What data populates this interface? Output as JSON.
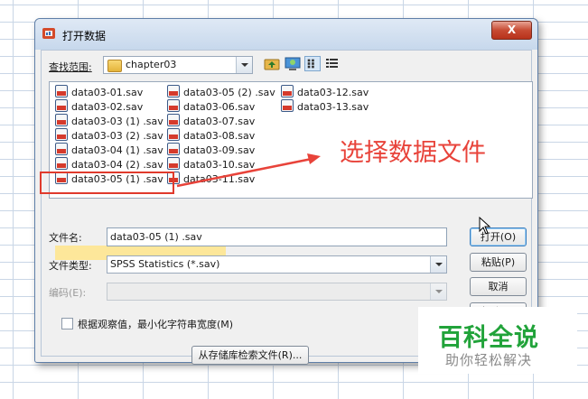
{
  "window": {
    "title": "打开数据",
    "close_label": "X"
  },
  "lookin": {
    "label": "查找范围:",
    "value": "chapter03"
  },
  "toolbar_icons": [
    "up-folder-icon",
    "desktop-icon",
    "list-view-icon",
    "details-view-icon"
  ],
  "files": {
    "col1": [
      "data03-01.sav",
      "data03-02.sav",
      "data03-03 (1) .sav",
      "data03-03 (2) .sav",
      "data03-04 (1) .sav",
      "data03-04 (2) .sav",
      "data03-05 (1) .sav"
    ],
    "col2": [
      "data03-05 (2) .sav",
      "data03-06.sav",
      "data03-07.sav",
      "data03-08.sav",
      "data03-09.sav",
      "data03-10.sav",
      "data03-11.sav"
    ],
    "col3": [
      "data03-12.sav",
      "data03-13.sav"
    ],
    "selected": "data03-05 (1) .sav"
  },
  "annotation": "选择数据文件",
  "filename": {
    "label": "文件名:",
    "value": "data03-05 (1) .sav"
  },
  "filetype": {
    "label": "文件类型:",
    "value": "SPSS Statistics (*.sav)"
  },
  "encoding": {
    "label": "编码(E):",
    "value": ""
  },
  "buttons": {
    "open": "打开(O)",
    "paste": "粘贴(P)",
    "cancel": "取消",
    "help": "帮助(H)"
  },
  "checkbox": {
    "label": "根据观察值，最小化字符串宽度(M)",
    "checked": false
  },
  "retrieve_button": "从存储库检索文件(R)...",
  "watermark": {
    "title": "百科全说",
    "subtitle": "助你轻松解决"
  },
  "colors": {
    "annotation": "#e8433a",
    "highlight": "#fde79a",
    "watermark_green": "#21a33a"
  }
}
